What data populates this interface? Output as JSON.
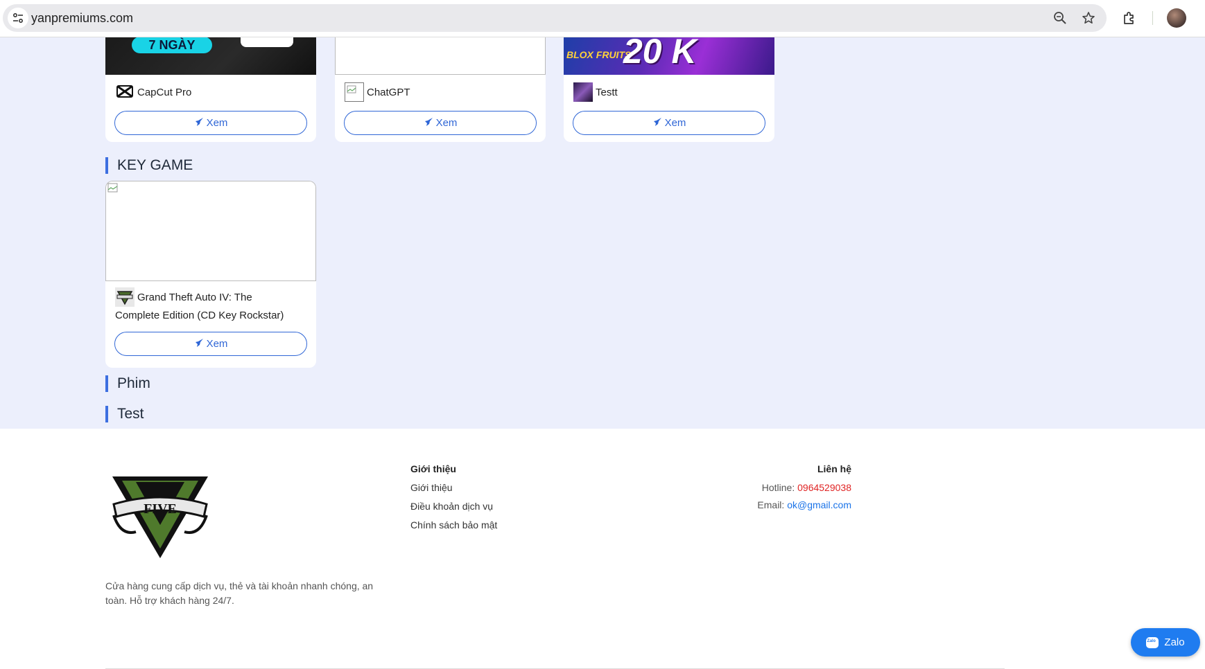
{
  "browser": {
    "url": "yanpremiums.com"
  },
  "cards_row1": [
    {
      "title": "CapCut Pro",
      "button": "Xem",
      "banner_text": "7 NGÀY"
    },
    {
      "title": "ChatGPT",
      "button": "Xem"
    },
    {
      "title": "Testt",
      "button": "Xem",
      "banner_text": "20 K",
      "banner_sub": "BLOX FRUITS"
    }
  ],
  "sections": {
    "key_game": "KEY GAME",
    "phim": "Phim",
    "test": "Test"
  },
  "key_game_card": {
    "title_line1": "Grand Theft Auto IV: The",
    "title_line2": "Complete Edition (CD Key Rockstar)",
    "button": "Xem"
  },
  "footer": {
    "logo_text": "FIVE",
    "description_line1": "Cửa hàng cung cấp dịch vụ, thẻ và tài khoản nhanh chóng, an",
    "description_line2": "toàn. Hỗ trợ khách hàng 24/7.",
    "intro_heading": "Giới thiệu",
    "links": [
      "Giới thiệu",
      "Điều khoản dịch vụ",
      "Chính sách bảo mật"
    ],
    "contact_heading": "Liên hệ",
    "hotline_label": "Hotline:",
    "hotline_value": "0964529038",
    "email_label": "Email:",
    "email_value": "ok@gmail.com"
  },
  "zalo": {
    "label": "Zalo",
    "icon_text": "Zalo"
  },
  "colors": {
    "accent": "#2f66d6",
    "page_bg": "#eceffc",
    "hotline": "#e02424",
    "email": "#1a73e8",
    "zalo": "#1f7cf0"
  }
}
